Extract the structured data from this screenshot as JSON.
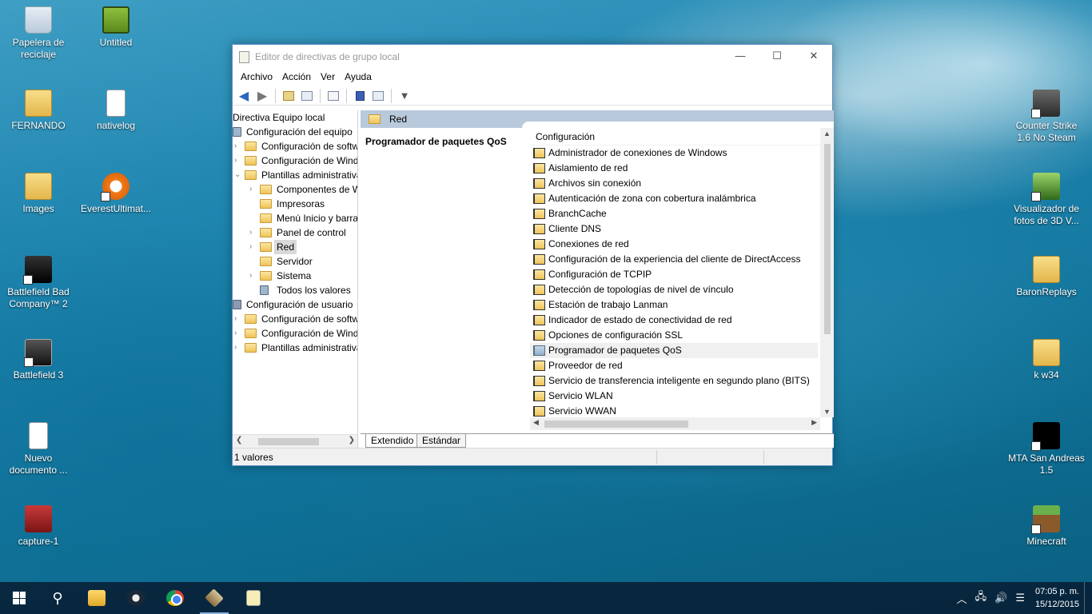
{
  "desktop": {
    "icons_left": [
      {
        "label": "Papelera de reciclaje",
        "icon": "recycle-bin-icon"
      },
      {
        "label": "FERNANDO",
        "icon": "user-folder-icon"
      },
      {
        "label": "Images",
        "icon": "folder-icon"
      },
      {
        "label": "Battlefield Bad Company™ 2",
        "icon": "bfbc2-icon"
      },
      {
        "label": "Battlefield 3",
        "icon": "bf3-icon"
      },
      {
        "label": "Nuevo documento ...",
        "icon": "document-icon"
      },
      {
        "label": "capture-1",
        "icon": "video-icon"
      }
    ],
    "icons_second": [
      {
        "label": "Untitled",
        "icon": "image-icon"
      },
      {
        "label": "nativelog",
        "icon": "text-file-icon"
      },
      {
        "label": "EverestUltimat...",
        "icon": "everest-icon"
      }
    ],
    "icons_right": [
      {
        "label": "Counter Strike 1.6 No Steam",
        "icon": "counter-strike-icon"
      },
      {
        "label": "Visualizador de fotos de 3D V...",
        "icon": "photo-viewer-icon"
      },
      {
        "label": "BaronReplays",
        "icon": "folder-icon"
      },
      {
        "label": "k w34",
        "icon": "folder-icon"
      },
      {
        "label": "MTA San Andreas 1.5",
        "icon": "mta-icon"
      },
      {
        "label": "Minecraft",
        "icon": "minecraft-icon"
      }
    ]
  },
  "window": {
    "title": "Editor de directivas de grupo local",
    "controls": {
      "minimize": "—",
      "maximize": "☐",
      "close": "✕"
    },
    "menu": [
      "Archivo",
      "Acción",
      "Ver",
      "Ayuda"
    ],
    "tree": [
      {
        "label": "Directiva Equipo local",
        "indent": 0,
        "chev": "",
        "icon": "none"
      },
      {
        "label": "Configuración del equipo",
        "indent": 0,
        "chev": "",
        "icon": "computer"
      },
      {
        "label": "Configuración de software",
        "indent": 1,
        "chev": "›",
        "icon": "folder"
      },
      {
        "label": "Configuración de Windows",
        "indent": 1,
        "chev": "›",
        "icon": "folder"
      },
      {
        "label": "Plantillas administrativas",
        "indent": 1,
        "chev": "⌄",
        "icon": "folder"
      },
      {
        "label": "Componentes de Windows",
        "indent": 2,
        "chev": "›",
        "icon": "folder"
      },
      {
        "label": "Impresoras",
        "indent": 2,
        "chev": "",
        "icon": "folder"
      },
      {
        "label": "Menú Inicio y barra de tareas",
        "indent": 2,
        "chev": "",
        "icon": "folder"
      },
      {
        "label": "Panel de control",
        "indent": 2,
        "chev": "›",
        "icon": "folder"
      },
      {
        "label": "Red",
        "indent": 2,
        "chev": "›",
        "icon": "folder",
        "selected": true
      },
      {
        "label": "Servidor",
        "indent": 2,
        "chev": "",
        "icon": "folder"
      },
      {
        "label": "Sistema",
        "indent": 2,
        "chev": "›",
        "icon": "folder"
      },
      {
        "label": "Todos los valores",
        "indent": 2,
        "chev": "",
        "icon": "settings"
      },
      {
        "label": "Configuración de usuario",
        "indent": 0,
        "chev": "",
        "icon": "user"
      },
      {
        "label": "Configuración de software",
        "indent": 1,
        "chev": "›",
        "icon": "folder"
      },
      {
        "label": "Configuración de Windows",
        "indent": 1,
        "chev": "›",
        "icon": "folder"
      },
      {
        "label": "Plantillas administrativas",
        "indent": 1,
        "chev": "›",
        "icon": "folder"
      }
    ],
    "right": {
      "header": "Red",
      "description_title": "Programador de paquetes QoS",
      "column_header": "Configuración",
      "items": [
        "Administrador de conexiones de Windows",
        "Aislamiento de red",
        "Archivos sin conexión",
        "Autenticación de zona con cobertura inalámbrica",
        "BranchCache",
        "Cliente DNS",
        "Conexiones de red",
        "Configuración de la experiencia del cliente de DirectAccess",
        "Configuración de TCPIP",
        "Detección de topologías de nivel de vínculo",
        "Estación de trabajo Lanman",
        "Indicador de estado de conectividad de red",
        "Opciones de configuración SSL",
        "Programador de paquetes QoS",
        "Proveedor de red",
        "Servicio de transferencia inteligente en segundo plano (BITS)",
        "Servicio WLAN",
        "Servicio WWAN"
      ],
      "highlighted_index": 13
    },
    "tabs": [
      "Extendido",
      "Estándar"
    ],
    "status": "1 valores"
  },
  "taskbar": {
    "apps": [
      "start-icon",
      "search-icon",
      "file-explorer-icon",
      "steam-icon",
      "chrome-icon",
      "gpedit-icon",
      "notepad-icon"
    ],
    "time": "07:05 p. m.",
    "date": "15/12/2015"
  },
  "colors": {
    "accent": "#5a8fc7",
    "header_band": "#b9c9dc",
    "taskbar": "#082238"
  }
}
